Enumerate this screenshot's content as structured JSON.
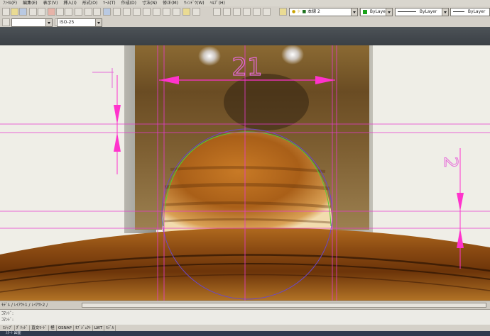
{
  "menu": {
    "items": [
      "ﾌｧｲﾙ(F)",
      "編集(E)",
      "表示(V)",
      "挿入(I)",
      "形式(O)",
      "ﾂｰﾙ(T)",
      "作成(D)",
      "寸法(N)",
      "修正(M)",
      "ｳｨﾝﾄﾞｳ(W)",
      "ﾍﾙﾌﾟ(H)"
    ]
  },
  "toolbar": {
    "dimstyle": "ISO-25",
    "layer": "本線 2",
    "color": "ByLayer",
    "linetype": "ByLayer",
    "lineweight": "ByLayer",
    "color_swatch": "#1aa31a"
  },
  "drawing": {
    "dim_width_text": "21",
    "dim_height_text": "2",
    "dim_color": "#ff33cc",
    "guide_color": "#e83acf",
    "circle_color": "#6a48c8",
    "arc_color": "#55cc33"
  },
  "layout_tabs": {
    "label": "ﾓﾃﾞﾙ / ﾚｲｱｳﾄ1 / ﾚｲｱｳﾄ2 /"
  },
  "command": {
    "line1": "ｺﾏﾝﾄﾞ:",
    "line2": "ｺﾏﾝﾄﾞ:"
  },
  "status": {
    "items": [
      "ｽﾅｯﾌﾟ",
      "ｸﾞﾘｯﾄﾞ",
      "直交ﾓｰﾄﾞ",
      "極",
      "OSNAP",
      "ｵﾌﾞｼﾞｪｸﾄ",
      "LWT",
      "ﾓﾃﾞﾙ"
    ]
  },
  "taskbar": {
    "label": "ｽﾀｰﾄ  図面"
  }
}
